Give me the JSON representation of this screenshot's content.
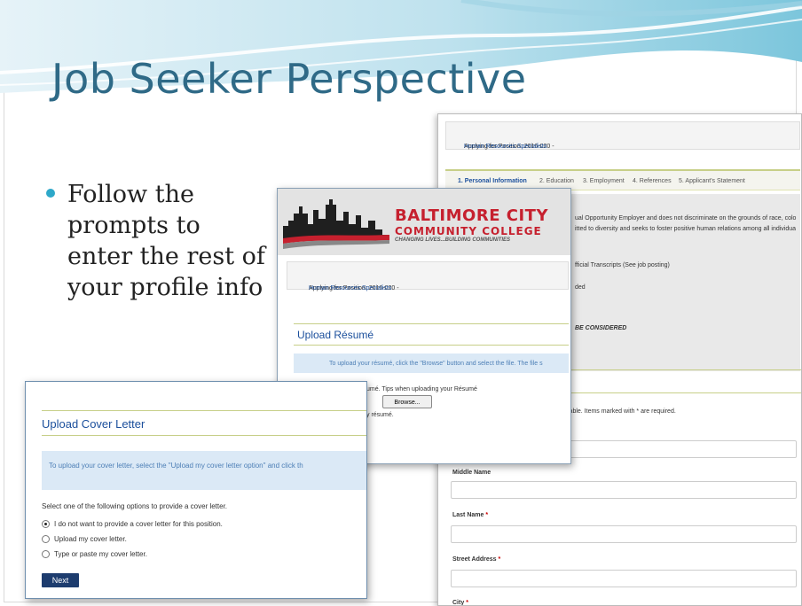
{
  "slide": {
    "title": "Job Seeker Perspective",
    "bullet": "Follow the prompts to enter the rest of your profile info"
  },
  "right_screenshot": {
    "applying_prefix": "Applying for Position: 2016-020 - ",
    "applying_link": "Human Resources Specialists",
    "tabs": [
      "1. Personal Information",
      "2. Education",
      "3. Employment",
      "4. References",
      "5. Applicant's Statement"
    ],
    "eeo_line1": "ual Opportunity Employer and does not discriminate on the grounds of race, colo",
    "eeo_line2": "itted to diversity and seeks to foster positive human relations among all individua",
    "transcripts_line": "fficial Transcripts (See job posting)",
    "ded_line": "ded",
    "considered_line": "BE CONSIDERED",
    "required_note": "lable. Items marked with * are required.",
    "labels": {
      "middle_name": "Middle Name",
      "last_name": "Last Name",
      "street_address": "Street Address",
      "city": "City"
    },
    "required_marker": "*"
  },
  "middle_screenshot": {
    "logo": {
      "line1": "BALTIMORE CITY",
      "line2": "COMMUNITY COLLEGE",
      "tagline": "CHANGING LIVES...BUILDING COMMUNITIES"
    },
    "applying_prefix": "Applying for Position: 2016-020 - ",
    "applying_link": "Human Resources Specialists",
    "heading": "Upload Résumé",
    "info_text": "To upload your résumé, click the \"Browse\" button and select the file. The file s",
    "tips_text": "umé. Tips when uploading your Résumé",
    "browse_label": "Browse...",
    "resume_text": "y résumé."
  },
  "left_screenshot": {
    "heading": "Upload Cover Letter",
    "info_text": "To upload your cover letter, select the \"Upload my cover letter option\" and click th",
    "prompt": "Select one of the following options to provide a cover letter.",
    "options": [
      {
        "label": "I do not want to provide a cover letter for this position.",
        "selected": true
      },
      {
        "label": "Upload my cover letter.",
        "selected": false
      },
      {
        "label": "Type or paste my cover letter.",
        "selected": false
      }
    ],
    "next_label": "Next"
  }
}
